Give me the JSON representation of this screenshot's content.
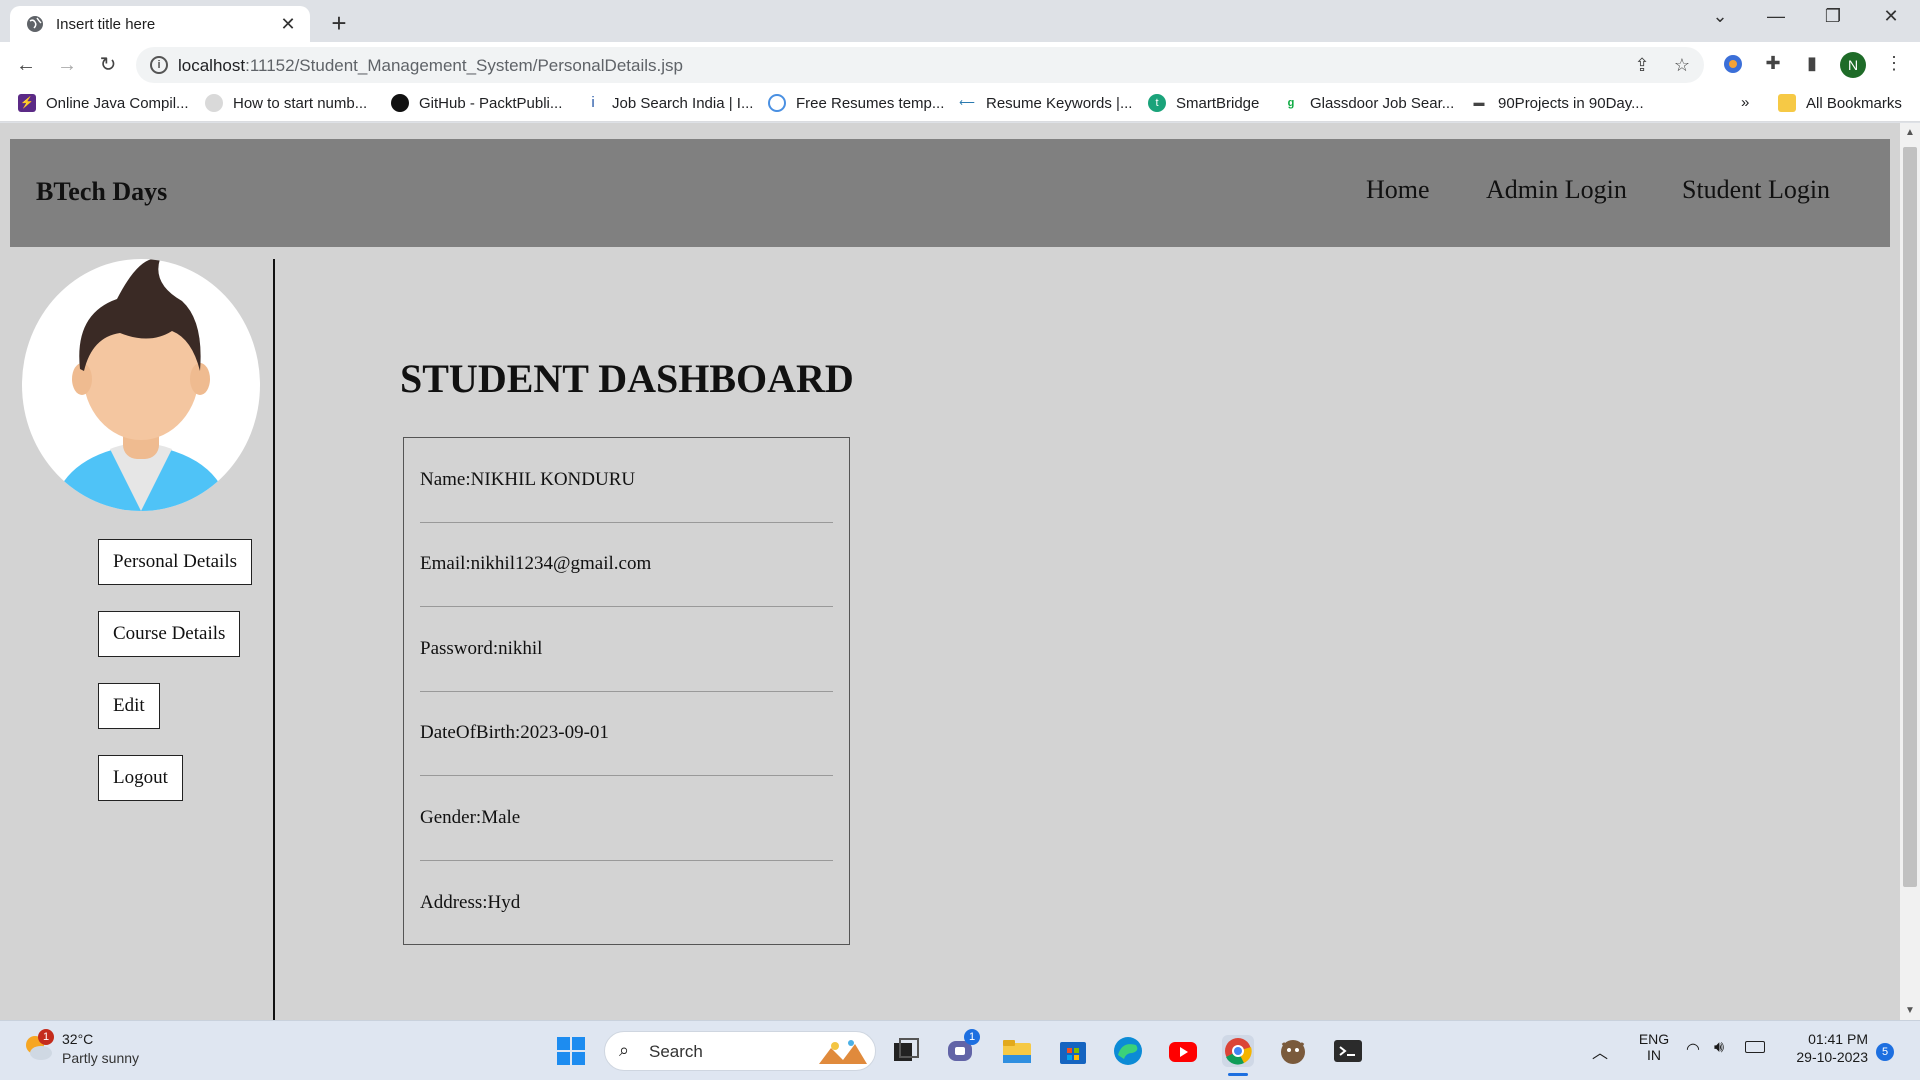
{
  "browser": {
    "tab_title": "Insert title here",
    "new_tab": "+",
    "url_host": "localhost",
    "url_rest": ":11152/Student_Management_System/PersonalDetails.jsp",
    "profile_initial": "N",
    "bookmarks": [
      {
        "label": "Online Java Compil...",
        "color": "#5b2a86"
      },
      {
        "label": "How to start numb...",
        "color": "#bdbdbd"
      },
      {
        "label": "GitHub - PacktPubli...",
        "color": "#111111"
      },
      {
        "label": "Job Search India | I...",
        "color": "#2557a7"
      },
      {
        "label": "Free Resumes temp...",
        "color": "#4a90e2"
      },
      {
        "label": "Resume Keywords |...",
        "color": "#2a7ab0"
      },
      {
        "label": "SmartBridge",
        "color": "#1aa37a"
      },
      {
        "label": "Glassdoor Job Sear...",
        "color": "#0caa41"
      },
      {
        "label": "90Projects in 90Day...",
        "color": "#444444"
      }
    ],
    "bookmarks_overflow": "»",
    "all_bookmarks": "All Bookmarks"
  },
  "site": {
    "brand": "BTech Days",
    "nav": [
      "Home",
      "Admin Login",
      "Student Login"
    ]
  },
  "sidebar": {
    "buttons": [
      "Personal Details",
      "Course Details",
      "Edit",
      "Logout"
    ]
  },
  "dashboard": {
    "title": "STUDENT DASHBOARD",
    "details": [
      "Name:NIKHIL KONDURU",
      "Email:nikhil1234@gmail.com",
      "Password:nikhil",
      "DateOfBirth:2023-09-01",
      "Gender:Male",
      "Address:Hyd"
    ]
  },
  "taskbar": {
    "weather_temp": "32°C",
    "weather_cond": "Partly sunny",
    "weather_badge": "1",
    "search": "Search",
    "teams_badge": "1",
    "lang": "ENG",
    "region": "IN",
    "time": "01:41 PM",
    "date": "29-10-2023",
    "notif_count": "5"
  }
}
